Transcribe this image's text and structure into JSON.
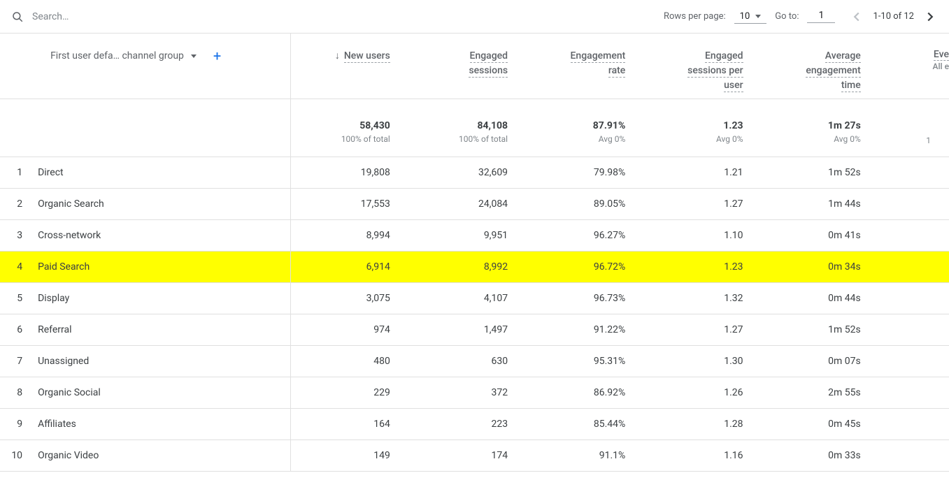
{
  "toolbar": {
    "search_placeholder": "Search…",
    "rows_per_page_label": "Rows per page:",
    "rows_per_page_value": "10",
    "go_to_label": "Go to:",
    "go_to_value": "1",
    "range_text": "1-10 of 12"
  },
  "dimension": {
    "label": "First user defa… channel group"
  },
  "columns": [
    {
      "label_lines": [
        "New users"
      ],
      "total": "58,430",
      "total_sub": "100% of total",
      "sorted": true
    },
    {
      "label_lines": [
        "Engaged",
        "sessions"
      ],
      "total": "84,108",
      "total_sub": "100% of total",
      "sorted": false
    },
    {
      "label_lines": [
        "Engagement",
        "rate"
      ],
      "total": "87.91%",
      "total_sub": "Avg 0%",
      "sorted": false
    },
    {
      "label_lines": [
        "Engaged",
        "sessions per",
        "user"
      ],
      "total": "1.23",
      "total_sub": "Avg 0%",
      "sorted": false
    },
    {
      "label_lines": [
        "Average",
        "engagement",
        "time"
      ],
      "total": "1m 27s",
      "total_sub": "Avg 0%",
      "sorted": false
    }
  ],
  "overflow_column": {
    "label_line1": "Eve",
    "label_line2": "All e",
    "total_partial": "1"
  },
  "rows": [
    {
      "idx": "1",
      "name": "Direct",
      "vals": [
        "19,808",
        "32,609",
        "79.98%",
        "1.21",
        "1m 52s"
      ],
      "highlight": false
    },
    {
      "idx": "2",
      "name": "Organic Search",
      "vals": [
        "17,553",
        "24,084",
        "89.05%",
        "1.27",
        "1m 44s"
      ],
      "highlight": false
    },
    {
      "idx": "3",
      "name": "Cross-network",
      "vals": [
        "8,994",
        "9,951",
        "96.27%",
        "1.10",
        "0m 41s"
      ],
      "highlight": false
    },
    {
      "idx": "4",
      "name": "Paid Search",
      "vals": [
        "6,914",
        "8,992",
        "96.72%",
        "1.23",
        "0m 34s"
      ],
      "highlight": true
    },
    {
      "idx": "5",
      "name": "Display",
      "vals": [
        "3,075",
        "4,107",
        "96.73%",
        "1.32",
        "0m 44s"
      ],
      "highlight": false
    },
    {
      "idx": "6",
      "name": "Referral",
      "vals": [
        "974",
        "1,497",
        "91.22%",
        "1.27",
        "1m 52s"
      ],
      "highlight": false
    },
    {
      "idx": "7",
      "name": "Unassigned",
      "vals": [
        "480",
        "630",
        "95.31%",
        "1.30",
        "0m 07s"
      ],
      "highlight": false
    },
    {
      "idx": "8",
      "name": "Organic Social",
      "vals": [
        "229",
        "372",
        "86.92%",
        "1.26",
        "2m 55s"
      ],
      "highlight": false
    },
    {
      "idx": "9",
      "name": "Affiliates",
      "vals": [
        "164",
        "223",
        "85.44%",
        "1.28",
        "0m 45s"
      ],
      "highlight": false
    },
    {
      "idx": "10",
      "name": "Organic Video",
      "vals": [
        "149",
        "174",
        "91.1%",
        "1.16",
        "0m 33s"
      ],
      "highlight": false
    }
  ]
}
